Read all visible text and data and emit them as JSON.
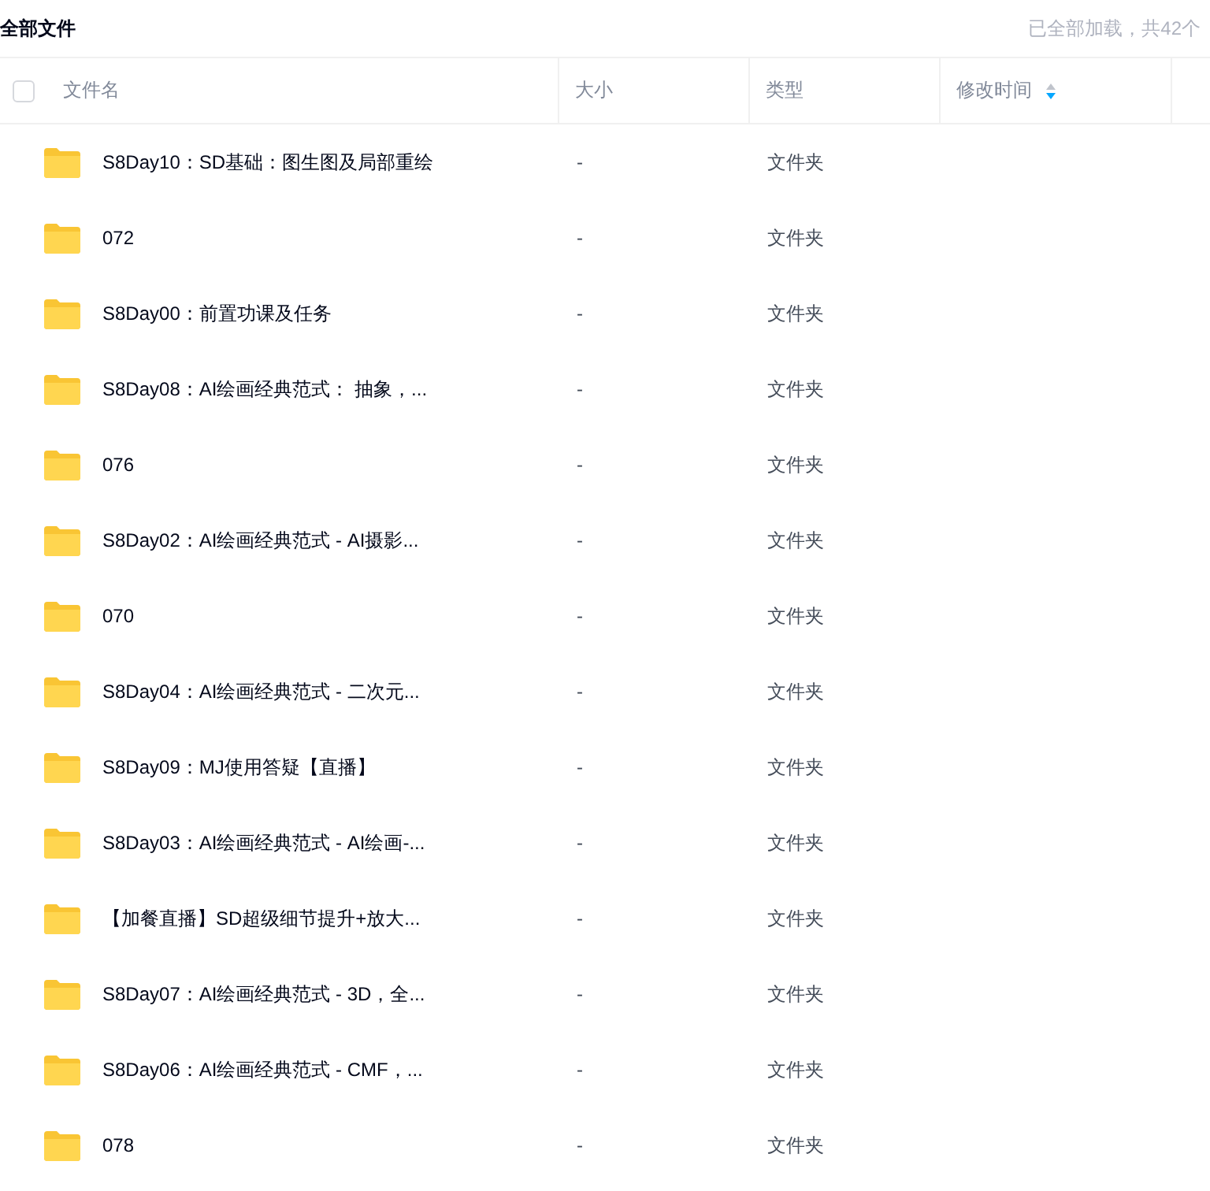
{
  "title": "全部文件",
  "load_status": "已全部加载，共42个",
  "table": {
    "select_all": {
      "checked": false
    },
    "columns": [
      {
        "label": "文件名",
        "kind": "plain"
      },
      {
        "label": "大小",
        "kind": "plain"
      },
      {
        "label": "类型",
        "kind": "plain"
      },
      {
        "label": "修改时间",
        "kind": "sortable"
      }
    ],
    "rows": [
      {
        "name": "S8Day10：SD基础：图生图及局部重绘",
        "size": "-",
        "type": "文件夹"
      },
      {
        "name": "072",
        "size": "-",
        "type": "文件夹"
      },
      {
        "name": "S8Day00：前置功课及任务",
        "size": "-",
        "type": "文件夹"
      },
      {
        "name": "S8Day08：AI绘画经典范式： 抽象，...",
        "size": "-",
        "type": "文件夹"
      },
      {
        "name": "076",
        "size": "-",
        "type": "文件夹"
      },
      {
        "name": "S8Day02：AI绘画经典范式 - AI摄影...",
        "size": "-",
        "type": "文件夹"
      },
      {
        "name": "070",
        "size": "-",
        "type": "文件夹"
      },
      {
        "name": "S8Day04：AI绘画经典范式 - 二次元...",
        "size": "-",
        "type": "文件夹"
      },
      {
        "name": "S8Day09：MJ使用答疑【直播】",
        "size": "-",
        "type": "文件夹"
      },
      {
        "name": "S8Day03：AI绘画经典范式 - AI绘画-...",
        "size": "-",
        "type": "文件夹"
      },
      {
        "name": "【加餐直播】SD超级细节提升+放大...",
        "size": "-",
        "type": "文件夹"
      },
      {
        "name": "S8Day07：AI绘画经典范式 - 3D，全...",
        "size": "-",
        "type": "文件夹"
      },
      {
        "name": "S8Day06：AI绘画经典范式 - CMF，...",
        "size": "-",
        "type": "文件夹"
      },
      {
        "name": "078",
        "size": "-",
        "type": "文件夹"
      }
    ]
  }
}
